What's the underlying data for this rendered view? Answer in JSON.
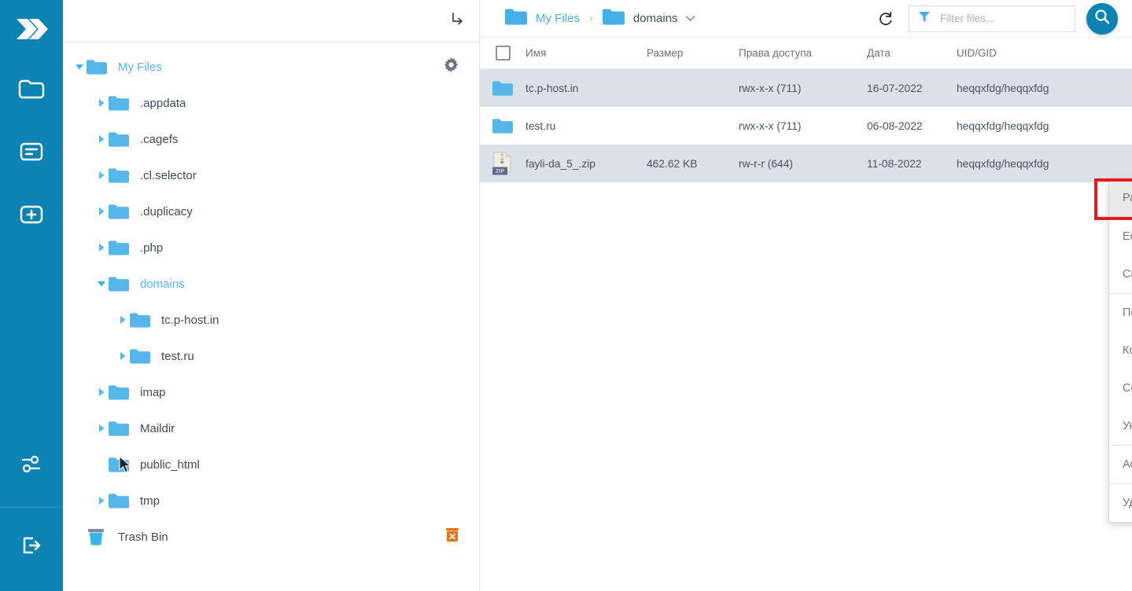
{
  "rail": {
    "logo": "double-chevron-logo",
    "items": [
      {
        "icon": "folder-icon",
        "name": "file-manager"
      },
      {
        "icon": "file-text-icon",
        "name": "logs"
      },
      {
        "icon": "plus-box-icon",
        "name": "create-new"
      }
    ],
    "mid": {
      "icon": "settings-sliders-icon",
      "name": "settings"
    },
    "bottom": {
      "icon": "logout-icon",
      "name": "logout"
    }
  },
  "tree": {
    "collapse_icon": "collapse-arrow-icon",
    "gear_icon": "gear-icon",
    "trash_delete_icon": "trash-delete-icon",
    "items": [
      {
        "label": "My Files",
        "level": 0,
        "expanded": true,
        "caret": "down",
        "root": true,
        "gear": true
      },
      {
        "label": ".appdata",
        "level": 1,
        "expanded": false,
        "caret": "right"
      },
      {
        "label": ".cagefs",
        "level": 1,
        "expanded": false,
        "caret": "right"
      },
      {
        "label": ".cl.selector",
        "level": 1,
        "expanded": false,
        "caret": "right"
      },
      {
        "label": ".duplicacy",
        "level": 1,
        "expanded": false,
        "caret": "right"
      },
      {
        "label": ".php",
        "level": 1,
        "expanded": false,
        "caret": "right"
      },
      {
        "label": "domains",
        "level": 1,
        "expanded": true,
        "caret": "down",
        "active": true
      },
      {
        "label": "tc.p-host.in",
        "level": 2,
        "expanded": false,
        "caret": "right"
      },
      {
        "label": "test.ru",
        "level": 2,
        "expanded": false,
        "caret": "right"
      },
      {
        "label": "imap",
        "level": 1,
        "expanded": false,
        "caret": "right"
      },
      {
        "label": "Maildir",
        "level": 1,
        "expanded": false,
        "caret": "right"
      },
      {
        "label": "public_html",
        "level": 1,
        "expanded": false,
        "caret": "none"
      },
      {
        "label": "tmp",
        "level": 1,
        "expanded": false,
        "caret": "right"
      },
      {
        "label": "Trash Bin",
        "level": 0,
        "caret": "none",
        "trash": true
      }
    ]
  },
  "toolbar": {
    "breadcrumb": [
      {
        "label": "My Files",
        "icon": "folder-icon"
      },
      {
        "label": "domains",
        "icon": "folder-icon",
        "caret": "chevron-down-icon"
      }
    ],
    "separator": "›",
    "refresh_icon": "refresh-icon",
    "filter_icon": "filter-funnel-icon",
    "filter_placeholder": "Filter files...",
    "filter_value": "",
    "search_icon": "search-icon"
  },
  "table": {
    "columns": [
      "",
      "Имя",
      "Размер",
      "Права доступа",
      "Дата",
      "UID/GID"
    ],
    "rows": [
      {
        "icon": "folder-icon",
        "name": "tc.p-host.in",
        "size": "",
        "perms": "rwx-x-x (711)",
        "date": "16-07-2022",
        "uidgid": "heqqxfdg/heqqxfdg",
        "shaded": true
      },
      {
        "icon": "folder-icon",
        "name": "test.ru",
        "size": "",
        "perms": "rwx-x-x (711)",
        "date": "06-08-2022",
        "uidgid": "heqqxfdg/heqqxfdg",
        "shaded": false
      },
      {
        "icon": "zip-file-icon",
        "name": "fayli-da_5_.zip",
        "size": "462.62 KB",
        "perms": "rw-r-r (644)",
        "date": "11-08-2022",
        "uidgid": "heqqxfdg/heqqxfdg",
        "shaded": true
      }
    ]
  },
  "context_menu": {
    "groups": [
      {
        "items": [
          {
            "label": "Распаковать",
            "highlighted": true
          }
        ]
      },
      {
        "items": [
          {
            "label": "Edit in new tab"
          },
          {
            "label": "Скачать"
          }
        ]
      },
      {
        "items": [
          {
            "label": "Переименовать"
          },
          {
            "label": "Копировать"
          },
          {
            "label": "Copy/Move to..."
          },
          {
            "label": "Указать права доступа"
          }
        ]
      },
      {
        "items": [
          {
            "label": "Add to archive"
          }
        ]
      },
      {
        "items": [
          {
            "label": "Удалить"
          }
        ]
      }
    ]
  },
  "annotation": {
    "highlight_color": "#e31b1b",
    "target": "Распаковать"
  },
  "colors": {
    "rail": "#0d83b4",
    "accent": "#45b0e8",
    "row_shade": "#dbe1e9",
    "text": "#49535e"
  }
}
